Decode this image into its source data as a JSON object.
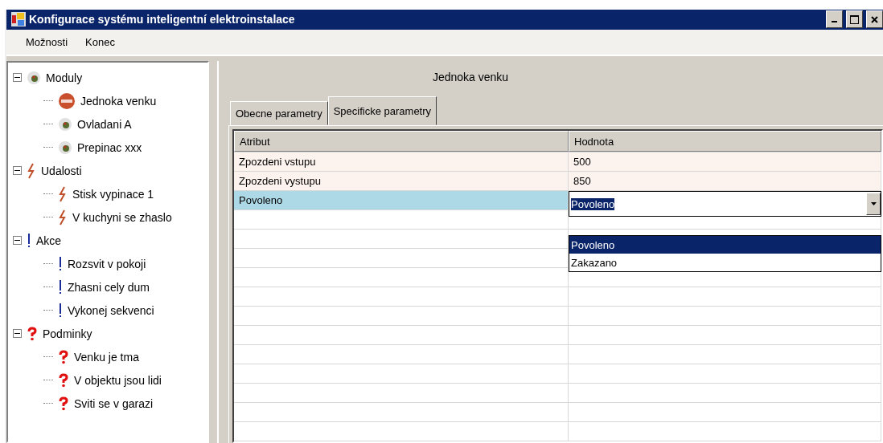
{
  "window": {
    "title": "Konfigurace systému inteligentní elektroinstalace"
  },
  "menu": [
    "Možnosti",
    "Konec"
  ],
  "tree": [
    {
      "label": "Moduly",
      "kind": "module",
      "expanded": true,
      "children": [
        {
          "label": "Jednoka venku",
          "kind": "active"
        },
        {
          "label": "Ovladani A",
          "kind": "module"
        },
        {
          "label": "Prepinac xxx",
          "kind": "module"
        }
      ]
    },
    {
      "label": "Udalosti",
      "kind": "event",
      "expanded": true,
      "children": [
        {
          "label": "Stisk vypinace 1",
          "kind": "event"
        },
        {
          "label": "V kuchyni se zhaslo",
          "kind": "event"
        }
      ]
    },
    {
      "label": "Akce",
      "kind": "action",
      "expanded": true,
      "children": [
        {
          "label": "Rozsvit v pokoji",
          "kind": "action"
        },
        {
          "label": "Zhasni cely dum",
          "kind": "action"
        },
        {
          "label": "Vykonej sekvenci",
          "kind": "action"
        }
      ]
    },
    {
      "label": "Podminky",
      "kind": "condition",
      "expanded": true,
      "children": [
        {
          "label": "Venku je tma",
          "kind": "condition"
        },
        {
          "label": "V objektu jsou lidi",
          "kind": "condition"
        },
        {
          "label": "Sviti se v garazi",
          "kind": "condition"
        }
      ]
    }
  ],
  "panel": {
    "title": "Jednoka venku",
    "tabs": [
      {
        "label": "Obecne parametry",
        "selected": false
      },
      {
        "label": "Specificke parametry",
        "selected": true
      }
    ],
    "table": {
      "columns": [
        "Atribut",
        "Hodnota"
      ],
      "rows": [
        {
          "kind": "text",
          "attribute": "Zpozdeni vstupu",
          "value": "500",
          "selected": false
        },
        {
          "kind": "text",
          "attribute": "Zpozdeni vystupu",
          "value": "850",
          "selected": false
        },
        {
          "kind": "combo",
          "attribute": "Povoleno",
          "value": "Povoleno",
          "selected": true,
          "options": [
            {
              "label": "Povoleno",
              "selected": true
            },
            {
              "label": "Zakazano",
              "selected": false
            }
          ]
        }
      ]
    }
  }
}
